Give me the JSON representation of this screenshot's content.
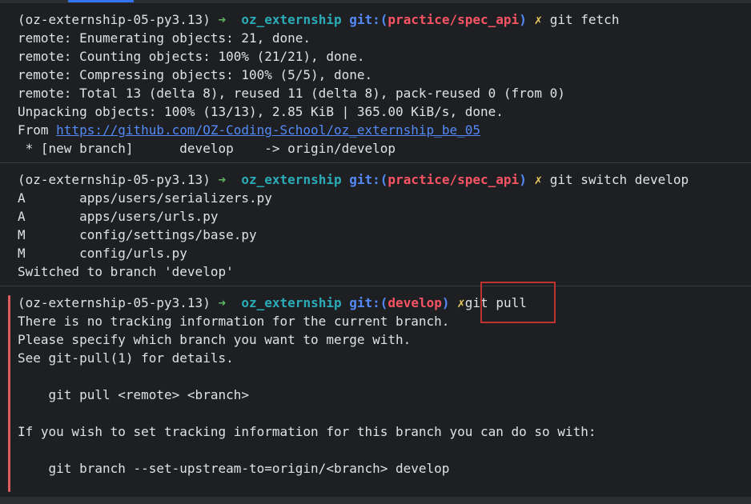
{
  "blocks": [
    {
      "prompt": {
        "env": "(oz-externship-05-py3.13)",
        "arrow": "➜",
        "repo": "oz_externship",
        "git_open": "git:(",
        "branch": "practice/spec_api",
        "git_close": ")",
        "dirty": "✗",
        "command": "git fetch"
      },
      "output": [
        "remote: Enumerating objects: 21, done.",
        "remote: Counting objects: 100% (21/21), done.",
        "remote: Compressing objects: 100% (5/5), done.",
        "remote: Total 13 (delta 8), reused 11 (delta 8), pack-reused 0 (from 0)",
        "Unpacking objects: 100% (13/13), 2.85 KiB | 365.00 KiB/s, done."
      ],
      "from_prefix": "From ",
      "from_url": "https://github.com/OZ-Coding-School/oz_externship_be_05",
      "new_branch_line": " * [new branch]      develop    -> origin/develop"
    },
    {
      "prompt": {
        "env": "(oz-externship-05-py3.13)",
        "arrow": "➜",
        "repo": "oz_externship",
        "git_open": "git:(",
        "branch": "practice/spec_api",
        "git_close": ")",
        "dirty": "✗",
        "command": "git switch develop"
      },
      "output": [
        "A       apps/users/serializers.py",
        "A       apps/users/urls.py",
        "M       config/settings/base.py",
        "M       config/urls.py",
        "Switched to branch 'develop'"
      ]
    },
    {
      "prompt": {
        "env": "(oz-externship-05-py3.13)",
        "arrow": "➜",
        "repo": "oz_externship",
        "git_open": "git:(",
        "branch": "develop",
        "git_close": ")",
        "dirty": "✗",
        "command": "git pull"
      },
      "output": [
        "There is no tracking information for the current branch.",
        "Please specify which branch you want to merge with.",
        "See git-pull(1) for details.",
        "",
        "    git pull <remote> <branch>",
        "",
        "If you wish to set tracking information for this branch you can do so with:",
        "",
        "    git branch --set-upstream-to=origin/<branch> develop"
      ]
    }
  ],
  "colors": {
    "background": "#1e1f22",
    "arrow": "#5fb865",
    "repo": "#2aacb8",
    "git_label": "#548af7",
    "branch": "#f75464",
    "dirty": "#e6c85c",
    "error_gutter": "#db5c5c",
    "highlight_box": "#c0322e"
  }
}
